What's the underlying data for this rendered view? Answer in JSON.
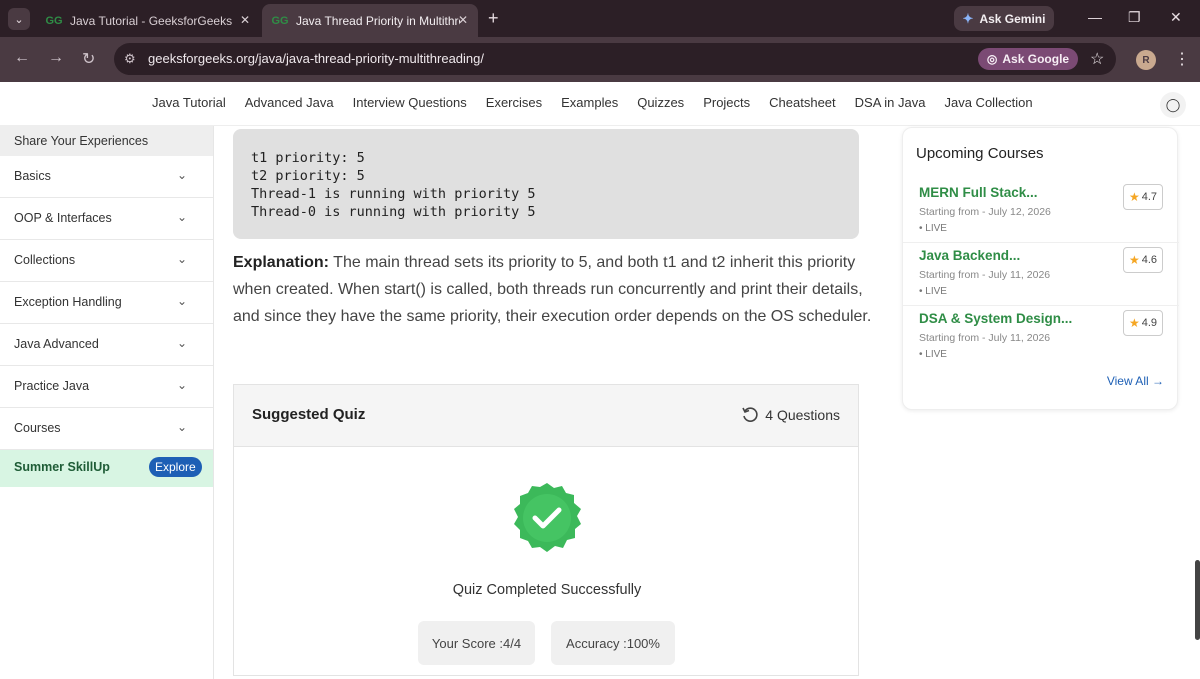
{
  "browser": {
    "tabs": [
      {
        "title": "Java Tutorial - GeeksforGeeks",
        "favicon": "GG"
      },
      {
        "title": "Java Thread Priority in Multithreading",
        "favicon": "GG",
        "active": true
      }
    ],
    "gemini_label": "Ask Gemini",
    "url": "geeksforgeeks.org/java/java-thread-priority-multithreading/",
    "ask_google_label": "Ask Google",
    "profile_initial": "R"
  },
  "site_nav": {
    "links": [
      "Java Tutorial",
      "Advanced Java",
      "Interview Questions",
      "Exercises",
      "Examples",
      "Quizzes",
      "Projects",
      "Cheatsheet",
      "DSA in Java",
      "Java Collection"
    ]
  },
  "sidebar": {
    "share_label": "Share Your Experiences",
    "items": [
      "Basics",
      "OOP & Interfaces",
      "Collections",
      "Exception Handling",
      "Java Advanced",
      "Practice Java",
      "Courses"
    ],
    "promo_label": "Summer SkillUp",
    "promo_button": "Explore"
  },
  "main": {
    "output_lines": [
      "t1 priority: 5",
      "t2 priority: 5",
      "Thread-1 is running with priority 5",
      "Thread-0 is running with priority 5"
    ],
    "explanation_label": "Explanation:",
    "explanation_text": " The main thread sets its priority to 5, and both t1 and t2 inherit this priority when created. When start() is called, both threads run concurrently and print their details, and since they have the same priority, their execution order depends on the OS scheduler.",
    "quiz": {
      "title": "Suggested Quiz",
      "count": "4 Questions",
      "status": "Quiz Completed Successfully",
      "score": "Your Score :4/4",
      "accuracy": "Accuracy :100%"
    }
  },
  "upcoming": {
    "title": "Upcoming Courses",
    "courses": [
      {
        "name": "MERN Full Stack...",
        "date": "Starting from - July 12, 2026",
        "status": "• LIVE",
        "rating": "4.7"
      },
      {
        "name": "Java Backend...",
        "date": "Starting from - July 11, 2026",
        "status": "• LIVE",
        "rating": "4.6"
      },
      {
        "name": "DSA & System Design...",
        "date": "Starting from - July 11, 2026",
        "status": "• LIVE",
        "rating": "4.9"
      }
    ],
    "view_all": "View All"
  },
  "colors": {
    "brand_green": "#2f8d46",
    "badge_green": "#3cb95a",
    "link_blue": "#1d5fb5",
    "chrome_dark": "#2c1f26"
  }
}
